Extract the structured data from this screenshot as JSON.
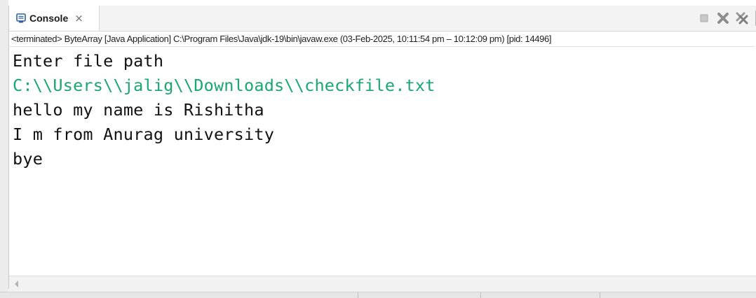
{
  "console_view": {
    "tab_label": "Console",
    "tab_close_glyph": "×",
    "process_line": "<terminated> ByteArray [Java Application] C:\\Program Files\\Java\\jdk-19\\bin\\javaw.exe  (03-Feb-2025, 10:11:54 pm – 10:12:09 pm) [pid: 14496]",
    "toolbar_icons": [
      "terminate-icon",
      "remove-launch-icon",
      "remove-all-terminated-icon"
    ]
  },
  "output": {
    "lines": [
      {
        "text": "Enter file path",
        "kind": "stdout"
      },
      {
        "text": "C:\\\\Users\\\\jalig\\\\Downloads\\\\checkfile.txt",
        "kind": "stdin"
      },
      {
        "text": "hello my name is Rishitha",
        "kind": "stdout"
      },
      {
        "text": "I m from Anurag university",
        "kind": "stdout"
      },
      {
        "text": "bye",
        "kind": "stdout"
      }
    ]
  },
  "colors": {
    "stdout": "#111111",
    "stdin": "#1aa672",
    "tab_icon": "#2f5fa8"
  }
}
